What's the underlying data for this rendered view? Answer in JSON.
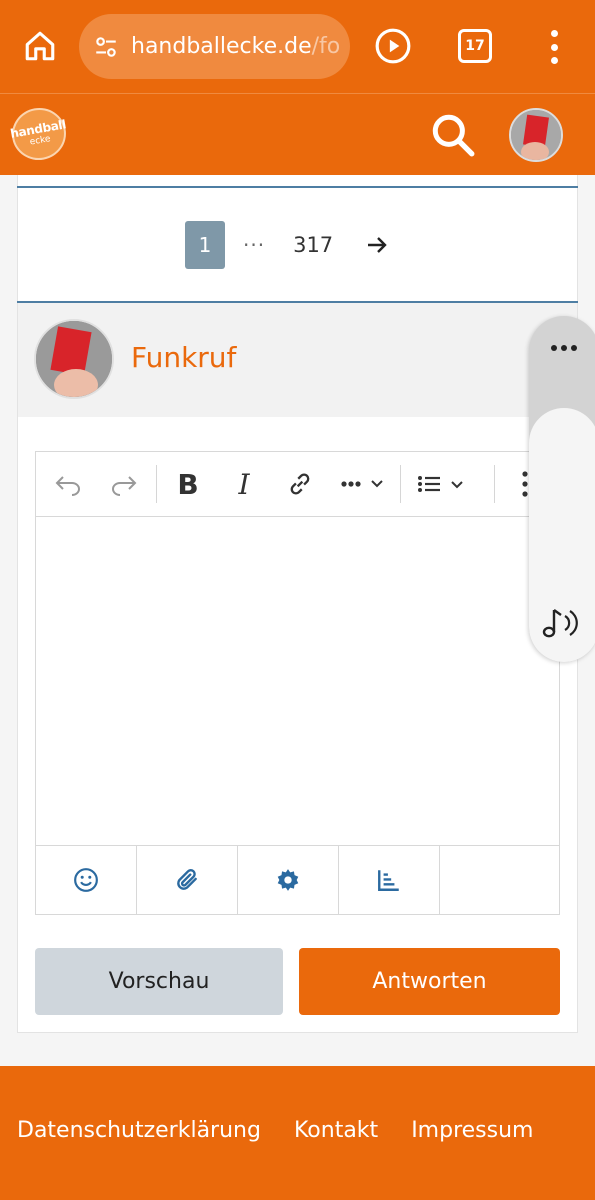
{
  "browser": {
    "url_host": "handballecke.de",
    "url_rest": "/fo",
    "tab_count": "17"
  },
  "site": {
    "logo_line1": "handball",
    "logo_line2": "ecke"
  },
  "pagination": {
    "current": "1",
    "ellipsis": "···",
    "last": "317"
  },
  "reply": {
    "username": "Funkruf"
  },
  "editor": {
    "toolbar": {
      "bold_label": "B",
      "italic_label": "I"
    }
  },
  "actions": {
    "preview_label": "Vorschau",
    "reply_label": "Antworten"
  },
  "footer": {
    "links": [
      "Datenschutzerklärung",
      "Kontakt",
      "Impressum"
    ]
  },
  "colors": {
    "brand": "#ea690c",
    "page_active": "#7f98a8",
    "rule": "#4e7ea3",
    "icon_blue": "#2b6aa0"
  }
}
